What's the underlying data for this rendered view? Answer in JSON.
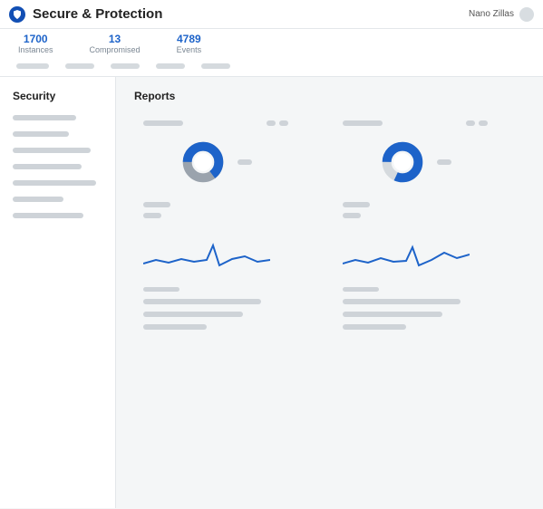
{
  "header": {
    "app_title": "Secure & Protection",
    "user_name": "Nano Zillas"
  },
  "stats": [
    {
      "value": "1700",
      "label": "Instances"
    },
    {
      "value": "13",
      "label": "Compromised"
    },
    {
      "value": "4789",
      "label": "Events"
    }
  ],
  "sidebar": {
    "title": "Security"
  },
  "main": {
    "title": "Reports"
  },
  "colors": {
    "accent": "#1d63c9",
    "muted": "#ced3d8"
  },
  "chart_data": [
    {
      "type": "pie",
      "title": "",
      "series": [
        {
          "name": "primary",
          "value": 65,
          "color": "#1d63c9"
        },
        {
          "name": "secondary",
          "value": 35,
          "color": "#9aa3ad"
        }
      ]
    },
    {
      "type": "pie",
      "title": "",
      "series": [
        {
          "name": "primary",
          "value": 82,
          "color": "#1d63c9"
        },
        {
          "name": "secondary",
          "value": 18,
          "color": "#d5dade"
        }
      ]
    },
    {
      "type": "line",
      "title": "",
      "x": [
        0,
        1,
        2,
        3,
        4,
        5,
        6,
        7,
        8,
        9,
        10
      ],
      "series": [
        {
          "name": "trend",
          "values": [
            28,
            24,
            27,
            23,
            26,
            24,
            8,
            30,
            23,
            20,
            26
          ],
          "color": "#1d63c9"
        }
      ],
      "ylim": [
        0,
        40
      ]
    },
    {
      "type": "line",
      "title": "",
      "x": [
        0,
        1,
        2,
        3,
        4,
        5,
        6,
        7,
        8,
        9,
        10
      ],
      "series": [
        {
          "name": "trend",
          "values": [
            28,
            24,
            27,
            22,
            26,
            25,
            10,
            30,
            24,
            16,
            22
          ],
          "color": "#1d63c9"
        }
      ],
      "ylim": [
        0,
        40
      ]
    }
  ]
}
